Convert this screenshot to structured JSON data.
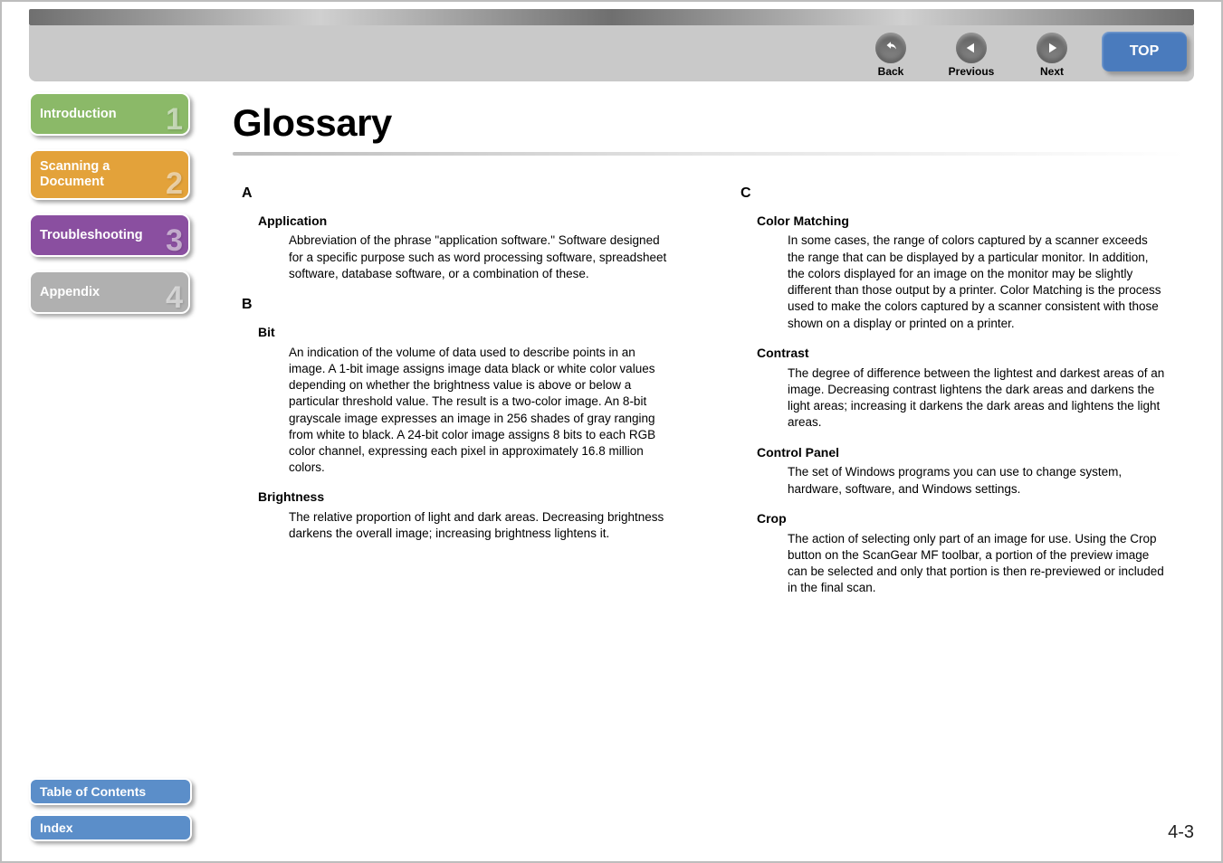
{
  "header": {
    "nav": {
      "back": "Back",
      "previous": "Previous",
      "next": "Next",
      "top": "TOP"
    }
  },
  "sidebar": {
    "items": [
      {
        "label": "Introduction",
        "num": "1"
      },
      {
        "label": "Scanning a Document",
        "num": "2"
      },
      {
        "label": "Troubleshooting",
        "num": "3"
      },
      {
        "label": "Appendix",
        "num": "4"
      }
    ]
  },
  "bottom": {
    "toc": "Table of Contents",
    "index": "Index"
  },
  "page": {
    "title": "Glossary",
    "number": "4-3"
  },
  "glossary": {
    "left": [
      {
        "letter": "A",
        "entries": [
          {
            "term": "Application",
            "def": "Abbreviation of the phrase \"application software.\" Software designed for a specific purpose such as word processing software, spreadsheet software, database software, or a combination of these."
          }
        ]
      },
      {
        "letter": "B",
        "entries": [
          {
            "term": "Bit",
            "def": "An indication of the volume of data used to describe points in an image. A 1-bit image assigns image data black or white color values depending on whether the brightness value is above or below a particular threshold value. The result is a two-color image. An 8-bit grayscale image expresses an image in 256 shades of gray ranging from white to black. A 24-bit color image assigns 8 bits to each RGB color channel, expressing each pixel in approximately 16.8 million colors."
          },
          {
            "term": "Brightness",
            "def": "The relative proportion of light and dark areas. Decreasing brightness darkens the overall image; increasing brightness lightens it."
          }
        ]
      }
    ],
    "right": [
      {
        "letter": "C",
        "entries": [
          {
            "term": "Color Matching",
            "def": "In some cases, the range of colors captured by a scanner exceeds the range that can be displayed by a particular monitor. In addition, the colors displayed for an image on the monitor may be slightly different than those output by a printer. Color Matching is the process used to make the colors captured by a scanner consistent with those shown on a display or printed on a printer."
          },
          {
            "term": "Contrast",
            "def": "The degree of difference between the lightest and darkest areas of an image. Decreasing contrast lightens the dark areas and darkens the light areas; increasing it darkens the dark areas and lightens the light areas."
          },
          {
            "term": "Control Panel",
            "def": "The set of Windows programs you can use to change system, hardware, software, and Windows settings."
          },
          {
            "term": "Crop",
            "def": "The action of selecting only part of an image for use. Using the Crop button on the ScanGear MF toolbar, a portion of the preview image can be selected and only that portion is then re-previewed or included in the final scan."
          }
        ]
      }
    ]
  }
}
